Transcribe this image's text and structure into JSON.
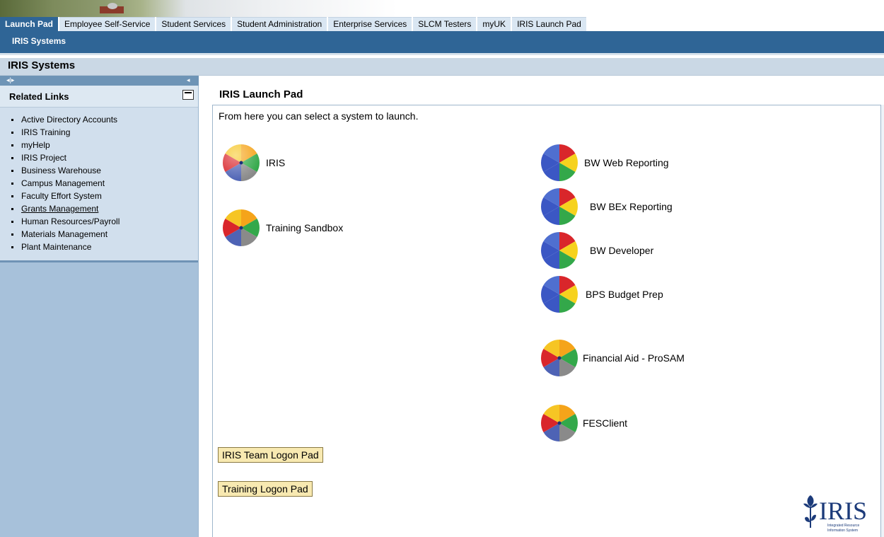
{
  "tabs": [
    {
      "label": "Launch Pad",
      "active": true
    },
    {
      "label": "Employee Self-Service"
    },
    {
      "label": "Student Services"
    },
    {
      "label": "Student Administration"
    },
    {
      "label": "Enterprise Services"
    },
    {
      "label": "SLCM Testers"
    },
    {
      "label": "myUK"
    },
    {
      "label": "IRIS Launch Pad"
    }
  ],
  "subnav": {
    "label": "IRIS Systems"
  },
  "page": {
    "title": "IRIS Systems"
  },
  "sidebar": {
    "title": "Related Links",
    "links": [
      "Active Directory Accounts",
      "IRIS Training",
      "myHelp",
      "IRIS Project",
      "Business Warehouse",
      "Campus Management",
      "Faculty Effort System",
      "Grants Management",
      "Human Resources/Payroll",
      "Materials Management",
      "Plant Maintenance"
    ]
  },
  "content": {
    "title": "IRIS Launch Pad",
    "intro": "From here you can select a system to launch.",
    "systems_left": [
      {
        "label": "IRIS",
        "icon": "sap-orange-ball-icon"
      },
      {
        "label": "Training Sandbox",
        "icon": "sap-orange-ball-icon"
      }
    ],
    "systems_right": [
      {
        "label": "BW Web Reporting",
        "icon": "bw-blue-ball-icon"
      },
      {
        "label": "BW BEx Reporting",
        "icon": "bw-blue-ball-icon"
      },
      {
        "label": "BW Developer",
        "icon": "bw-blue-ball-icon"
      },
      {
        "label": "BPS Budget Prep",
        "icon": "bw-blue-ball-icon"
      },
      {
        "label": "Financial Aid - ProSAM",
        "icon": "sap-orange-ball-icon"
      },
      {
        "label": "FESClient",
        "icon": "sap-orange-ball-icon"
      }
    ],
    "buttons": {
      "team_logon": "IRIS Team Logon Pad",
      "training_logon": "Training Logon Pad"
    }
  },
  "logo": {
    "text": "IRIS",
    "tagline_1": "Integrated Resource",
    "tagline_2": "Information System"
  },
  "colors": {
    "nav": "#2f6596",
    "sidebar": "#a7c1da",
    "tab_inactive": "#d9e6f2",
    "pad_button": "#f8e9b1"
  }
}
